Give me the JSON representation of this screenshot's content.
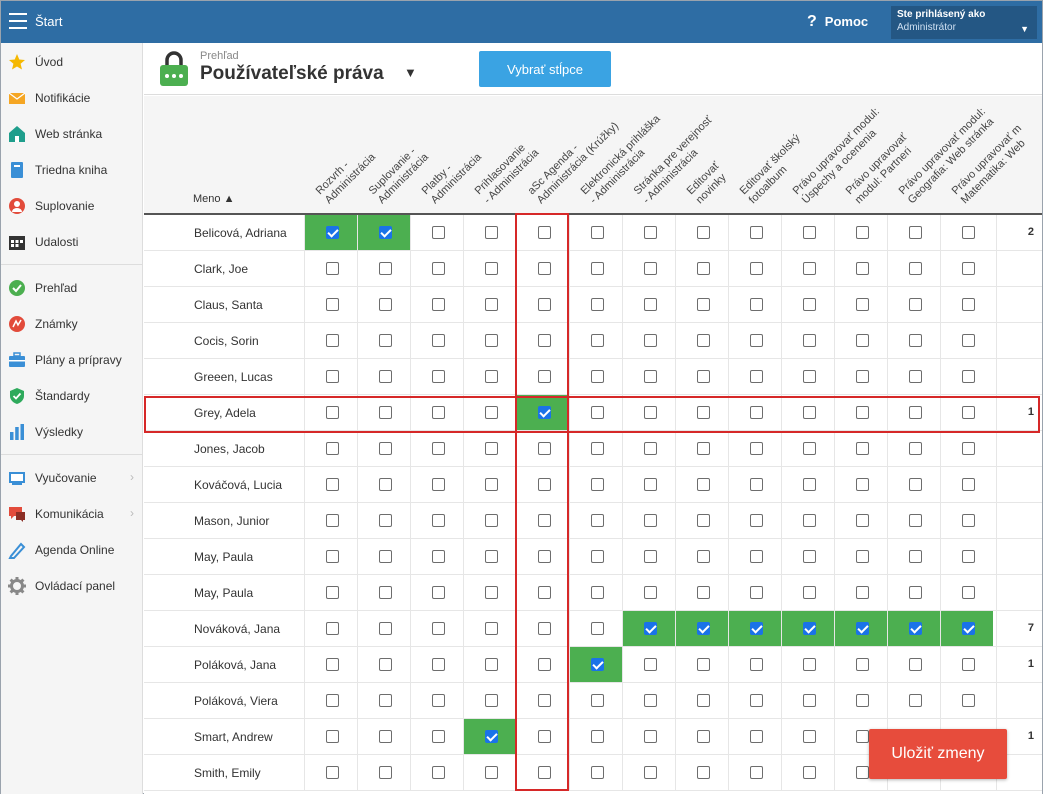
{
  "topbar": {
    "title": "Štart",
    "help_label": "Pomoc",
    "help_icon": "?",
    "user_line1": "Ste prihlásený ako",
    "user_line2": "Administrátor"
  },
  "sidebar": {
    "items": [
      {
        "label": "Úvod",
        "icon": "star-icon",
        "color": "#f5b800"
      },
      {
        "label": "Notifikácie",
        "icon": "envelope-icon",
        "color": "#f5a623"
      },
      {
        "label": "Web stránka",
        "icon": "home-icon",
        "color": "#1f9e8c"
      },
      {
        "label": "Triedna kniha",
        "icon": "book-icon",
        "color": "#3a8fd6"
      },
      {
        "label": "Suplovanie",
        "icon": "person-icon",
        "color": "#e24b3b"
      },
      {
        "label": "Udalosti",
        "icon": "calendar-icon",
        "color": "#333333"
      },
      {
        "label": "Prehľad",
        "icon": "check-circle-icon",
        "color": "#4caf50"
      },
      {
        "label": "Známky",
        "icon": "grade-icon",
        "color": "#e24b3b"
      },
      {
        "label": "Plány a prípravy",
        "icon": "briefcase-icon",
        "color": "#3a8fd6"
      },
      {
        "label": "Štandardy",
        "icon": "shield-icon",
        "color": "#2eaa5c"
      },
      {
        "label": "Výsledky",
        "icon": "bar-chart-icon",
        "color": "#3a8fd6"
      },
      {
        "label": "Vyučovanie",
        "icon": "classroom-icon",
        "color": "#3a8fd6"
      },
      {
        "label": "Komunikácia",
        "icon": "chat-icon",
        "color": "#e24b3b"
      },
      {
        "label": "Agenda Online",
        "icon": "pen-icon",
        "color": "#3a8fd6"
      },
      {
        "label": "Ovládací panel",
        "icon": "gear-icon",
        "color": "#888888"
      }
    ]
  },
  "header": {
    "breadcrumb": "Prehľad",
    "title": "Používateľské práva",
    "select_columns_label": "Vybrať stĺpce"
  },
  "table": {
    "name_header": "Meno ▲",
    "columns": [
      [
        "Rozvrh -",
        "Administrácia"
      ],
      [
        "Suplovanie -",
        "Administrácia"
      ],
      [
        "Platby -",
        "Administrácia"
      ],
      [
        "Prihlasovanie",
        "- Administrácia"
      ],
      [
        "aSc Agenda -",
        "Administrácia (Krúžky)"
      ],
      [
        "Elektronická prihláška",
        "- Administrácia"
      ],
      [
        "Stránka pre verejnosť",
        "- Administrácia"
      ],
      [
        "Editovať",
        "novinky"
      ],
      [
        "Editovať školský",
        "fotoalbum"
      ],
      [
        "Právo upravovať modul:",
        "Úspechy a ocenenia"
      ],
      [
        "Právo upravovať",
        "modul: Partneri"
      ],
      [
        "Právo upravovať modul:",
        "Geografia: Web stránka"
      ],
      [
        "Právo upravovať m",
        "Matematika: Web"
      ]
    ],
    "rows": [
      {
        "name": "Belicová, Adriana",
        "checked": [
          0,
          1
        ],
        "count": "2"
      },
      {
        "name": "Clark, Joe",
        "checked": [],
        "count": ""
      },
      {
        "name": "Claus, Santa",
        "checked": [],
        "count": ""
      },
      {
        "name": "Cocis, Sorin",
        "checked": [],
        "count": ""
      },
      {
        "name": "Greeen, Lucas",
        "checked": [],
        "count": ""
      },
      {
        "name": "Grey, Adela",
        "checked": [
          4
        ],
        "count": "1"
      },
      {
        "name": "Jones, Jacob",
        "checked": [],
        "count": ""
      },
      {
        "name": "Kováčová, Lucia",
        "checked": [],
        "count": ""
      },
      {
        "name": "Mason, Junior",
        "checked": [],
        "count": ""
      },
      {
        "name": "May, Paula",
        "checked": [],
        "count": ""
      },
      {
        "name": "May, Paula",
        "checked": [],
        "count": ""
      },
      {
        "name": "Nováková, Jana",
        "checked": [
          6,
          7,
          8,
          9,
          10,
          11,
          12
        ],
        "count": "7"
      },
      {
        "name": "Poláková, Jana",
        "checked": [
          5
        ],
        "count": "1"
      },
      {
        "name": "Poláková, Viera",
        "checked": [],
        "count": ""
      },
      {
        "name": "Smart, Andrew",
        "checked": [
          3
        ],
        "count": "1"
      },
      {
        "name": "Smith, Emily",
        "checked": [],
        "count": ""
      }
    ]
  },
  "save_label": "Uložiť zmeny",
  "colors": {
    "topbar": "#2e6da4",
    "checked_cell": "#4caf50",
    "highlight": "#d62828",
    "save_button": "#e74c3c",
    "select_button": "#3aa3e3"
  }
}
